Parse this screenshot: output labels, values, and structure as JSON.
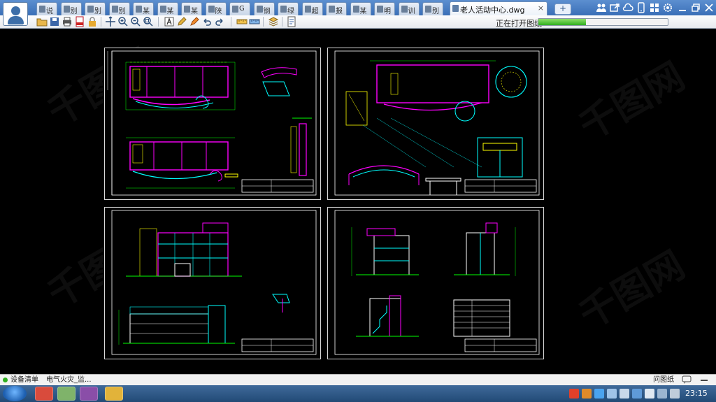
{
  "tabs": [
    {
      "label": "说"
    },
    {
      "label": "别"
    },
    {
      "label": "别"
    },
    {
      "label": "别"
    },
    {
      "label": "某"
    },
    {
      "label": "某"
    },
    {
      "label": "某"
    },
    {
      "label": "陕"
    },
    {
      "label": "G"
    },
    {
      "label": "钢"
    },
    {
      "label": "绿"
    },
    {
      "label": "超"
    },
    {
      "label": "报"
    },
    {
      "label": "某"
    },
    {
      "label": "明"
    },
    {
      "label": "训"
    },
    {
      "label": "别"
    }
  ],
  "active_tab": {
    "label": "老人活动中心.dwg",
    "close": "×"
  },
  "new_tab_symbol": "+",
  "toolbar": {
    "status_text": "正在打开图纸",
    "progress": 0.37
  },
  "bottom_strip": {
    "items": [
      {
        "label": "设备清单"
      },
      {
        "label": "电气火灾_监..."
      }
    ],
    "right_label": "问图纸"
  },
  "taskbar": {
    "clock": "23:15"
  },
  "watermark": "千图网",
  "colors": {
    "canvas": "#000000",
    "title_bar": "#3a6fb7",
    "cad_cyan": "#00ffff",
    "cad_yellow": "#ffff00",
    "cad_green": "#00ff00",
    "cad_magenta": "#ff00ff",
    "cad_white": "#ffffff",
    "cad_blue": "#3c64ff",
    "progress": "#2fae1f"
  }
}
